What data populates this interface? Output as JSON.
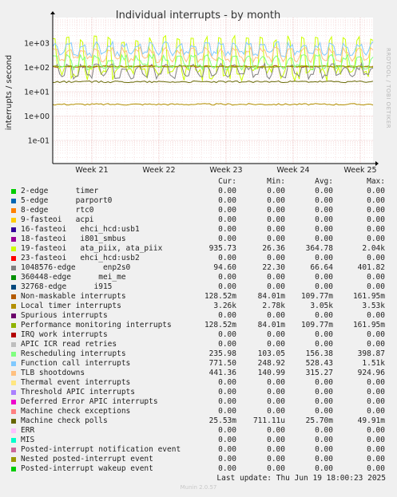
{
  "chart_data": {
    "type": "line",
    "title": "Individual interrupts - by month",
    "ylabel": "interrupts / second",
    "y_scale": "log",
    "ylim": [
      0.01,
      5000
    ],
    "y_ticks": [
      "1e-01",
      "1e+00",
      "1e+01",
      "1e+02",
      "1e+03"
    ],
    "x_ticks": [
      "Week 21",
      "Week 22",
      "Week 23",
      "Week 24",
      "Week 25"
    ],
    "grid": true,
    "side_text": "RRDTOOL / TOBI OETIKER",
    "columns": [
      "Cur:",
      "Min:",
      "Avg:",
      "Max:"
    ],
    "series": [
      {
        "name": "2-edge      timer",
        "color": "#00cc00",
        "cur": "0.00",
        "min": "0.00",
        "avg": "0.00",
        "max": "0.00"
      },
      {
        "name": "5-edge      parport0",
        "color": "#0066b3",
        "cur": "0.00",
        "min": "0.00",
        "avg": "0.00",
        "max": "0.00"
      },
      {
        "name": "8-edge      rtc0",
        "color": "#ff8000",
        "cur": "0.00",
        "min": "0.00",
        "avg": "0.00",
        "max": "0.00"
      },
      {
        "name": "9-fasteoi   acpi",
        "color": "#ffcc00",
        "cur": "0.00",
        "min": "0.00",
        "avg": "0.00",
        "max": "0.00"
      },
      {
        "name": "16-fasteoi   ehci_hcd:usb1",
        "color": "#330099",
        "cur": "0.00",
        "min": "0.00",
        "avg": "0.00",
        "max": "0.00"
      },
      {
        "name": "18-fasteoi   i801_smbus",
        "color": "#990099",
        "cur": "0.00",
        "min": "0.00",
        "avg": "0.00",
        "max": "0.00"
      },
      {
        "name": "19-fasteoi   ata_piix, ata_piix",
        "color": "#ccff00",
        "cur": "935.73",
        "min": "26.36",
        "avg": "364.78",
        "max": "2.04k"
      },
      {
        "name": "23-fasteoi   ehci_hcd:usb2",
        "color": "#ff0000",
        "cur": "0.00",
        "min": "0.00",
        "avg": "0.00",
        "max": "0.00"
      },
      {
        "name": "1048576-edge      enp2s0",
        "color": "#808080",
        "cur": "94.60",
        "min": "22.30",
        "avg": "66.64",
        "max": "401.82"
      },
      {
        "name": "360448-edge      mei_me",
        "color": "#008f00",
        "cur": "0.00",
        "min": "0.00",
        "avg": "0.00",
        "max": "0.00"
      },
      {
        "name": "32768-edge      i915",
        "color": "#00487d",
        "cur": "0.00",
        "min": "0.00",
        "avg": "0.00",
        "max": "0.00"
      },
      {
        "name": "Non-maskable interrupts",
        "color": "#b35a00",
        "cur": "128.52m",
        "min": "84.01m",
        "avg": "109.77m",
        "max": "161.95m"
      },
      {
        "name": "Local timer interrupts",
        "color": "#b38f00",
        "cur": "3.26k",
        "min": "2.78k",
        "avg": "3.05k",
        "max": "3.53k"
      },
      {
        "name": "Spurious interrupts",
        "color": "#6b006b",
        "cur": "0.00",
        "min": "0.00",
        "avg": "0.00",
        "max": "0.00"
      },
      {
        "name": "Performance monitoring interrupts",
        "color": "#8fb300",
        "cur": "128.52m",
        "min": "84.01m",
        "avg": "109.77m",
        "max": "161.95m"
      },
      {
        "name": "IRQ work interrupts",
        "color": "#b30000",
        "cur": "0.00",
        "min": "0.00",
        "avg": "0.00",
        "max": "0.00"
      },
      {
        "name": "APIC ICR read retries",
        "color": "#bebebe",
        "cur": "0.00",
        "min": "0.00",
        "avg": "0.00",
        "max": "0.00"
      },
      {
        "name": "Rescheduling interrupts",
        "color": "#80ff80",
        "cur": "235.98",
        "min": "103.05",
        "avg": "156.38",
        "max": "398.87"
      },
      {
        "name": "Function call interrupts",
        "color": "#80c9ff",
        "cur": "771.50",
        "min": "248.92",
        "avg": "528.43",
        "max": "1.51k"
      },
      {
        "name": "TLB shootdowns",
        "color": "#ffc080",
        "cur": "441.36",
        "min": "140.99",
        "avg": "315.27",
        "max": "924.96"
      },
      {
        "name": "Thermal event interrupts",
        "color": "#ffe680",
        "cur": "0.00",
        "min": "0.00",
        "avg": "0.00",
        "max": "0.00"
      },
      {
        "name": "Threshold APIC interrupts",
        "color": "#aa80ff",
        "cur": "0.00",
        "min": "0.00",
        "avg": "0.00",
        "max": "0.00"
      },
      {
        "name": "Deferred Error APIC interrupts",
        "color": "#ee00cc",
        "cur": "0.00",
        "min": "0.00",
        "avg": "0.00",
        "max": "0.00"
      },
      {
        "name": "Machine check exceptions",
        "color": "#ff8080",
        "cur": "0.00",
        "min": "0.00",
        "avg": "0.00",
        "max": "0.00"
      },
      {
        "name": "Machine check polls",
        "color": "#666600",
        "cur": "25.53m",
        "min": "711.11u",
        "avg": "25.70m",
        "max": "49.91m"
      },
      {
        "name": "ERR",
        "color": "#ffbfff",
        "cur": "0.00",
        "min": "0.00",
        "avg": "0.00",
        "max": "0.00"
      },
      {
        "name": "MIS",
        "color": "#00ffcc",
        "cur": "0.00",
        "min": "0.00",
        "avg": "0.00",
        "max": "0.00"
      },
      {
        "name": "Posted-interrupt notification event",
        "color": "#cc6699",
        "cur": "0.00",
        "min": "0.00",
        "avg": "0.00",
        "max": "0.00"
      },
      {
        "name": "Nested posted-interrupt event",
        "color": "#999900",
        "cur": "0.00",
        "min": "0.00",
        "avg": "0.00",
        "max": "0.00"
      },
      {
        "name": "Posted-interrupt wakeup event",
        "color": "#00cc00",
        "cur": "0.00",
        "min": "0.00",
        "avg": "0.00",
        "max": "0.00"
      }
    ]
  },
  "footer": {
    "last_update": "Last update: Thu Jun 19 18:00:23 2025",
    "munin": "Munin 2.0.57"
  }
}
